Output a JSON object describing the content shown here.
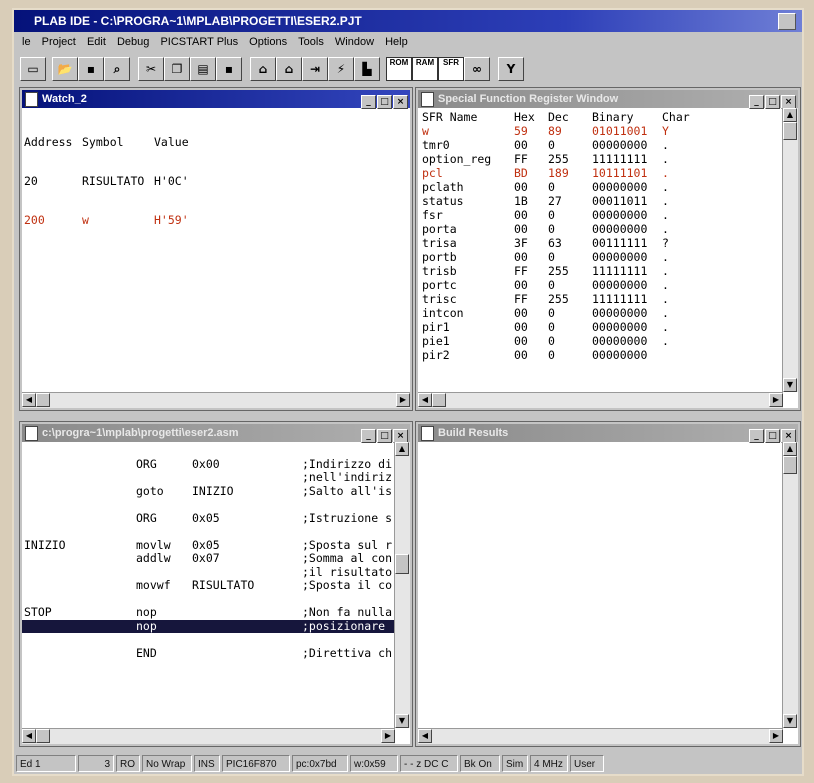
{
  "app": {
    "title": "PLAB IDE - C:\\PROGRA~1\\MPLAB\\PROGETTI\\ESER2.PJT"
  },
  "menu": [
    "le",
    "Project",
    "Edit",
    "Debug",
    "PICSTART Plus",
    "Options",
    "Tools",
    "Window",
    "Help"
  ],
  "toolbar": {
    "icons": [
      "project-icon",
      "open-icon",
      "save-icon",
      "find-icon",
      "cut-icon",
      "copy-icon",
      "paste-icon",
      "save-all-icon",
      "run-icon",
      "halt-icon",
      "step-icon",
      "animate-icon",
      "reset-icon",
      "rom-icon",
      "ram-icon",
      "sfr-icon",
      "watch-icon",
      "filter-icon"
    ],
    "rom_label": "ROM",
    "ram_label": "RAM",
    "sfr_label": "SFR"
  },
  "watch": {
    "title": "Watch_2",
    "headers": [
      "Address",
      "Symbol",
      "Value"
    ],
    "rows": [
      {
        "address": "20",
        "symbol": "RISULTATO",
        "value": "H'0C'",
        "changed": false
      },
      {
        "address": "200",
        "symbol": "w",
        "value": "H'59'",
        "changed": true
      }
    ]
  },
  "sfr": {
    "title": "Special Function Register Window",
    "headers": [
      "SFR Name",
      "Hex",
      "Dec",
      "Binary",
      "Char"
    ],
    "rows": [
      {
        "name": "w",
        "hex": "59",
        "dec": "89",
        "bin": "01011001",
        "ch": "Y",
        "changed": true
      },
      {
        "name": "tmr0",
        "hex": "00",
        "dec": "0",
        "bin": "00000000",
        "ch": ".",
        "changed": false
      },
      {
        "name": "option_reg",
        "hex": "FF",
        "dec": "255",
        "bin": "11111111",
        "ch": ".",
        "changed": false
      },
      {
        "name": "pcl",
        "hex": "BD",
        "dec": "189",
        "bin": "10111101",
        "ch": ".",
        "changed": true
      },
      {
        "name": "pclath",
        "hex": "00",
        "dec": "0",
        "bin": "00000000",
        "ch": ".",
        "changed": false
      },
      {
        "name": "status",
        "hex": "1B",
        "dec": "27",
        "bin": "00011011",
        "ch": ".",
        "changed": false
      },
      {
        "name": "fsr",
        "hex": "00",
        "dec": "0",
        "bin": "00000000",
        "ch": ".",
        "changed": false
      },
      {
        "name": "porta",
        "hex": "00",
        "dec": "0",
        "bin": "00000000",
        "ch": ".",
        "changed": false
      },
      {
        "name": "trisa",
        "hex": "3F",
        "dec": "63",
        "bin": "00111111",
        "ch": "?",
        "changed": false
      },
      {
        "name": "portb",
        "hex": "00",
        "dec": "0",
        "bin": "00000000",
        "ch": ".",
        "changed": false
      },
      {
        "name": "trisb",
        "hex": "FF",
        "dec": "255",
        "bin": "11111111",
        "ch": ".",
        "changed": false
      },
      {
        "name": "portc",
        "hex": "00",
        "dec": "0",
        "bin": "00000000",
        "ch": ".",
        "changed": false
      },
      {
        "name": "trisc",
        "hex": "FF",
        "dec": "255",
        "bin": "11111111",
        "ch": ".",
        "changed": false
      },
      {
        "name": "intcon",
        "hex": "00",
        "dec": "0",
        "bin": "00000000",
        "ch": ".",
        "changed": false
      },
      {
        "name": "pir1",
        "hex": "00",
        "dec": "0",
        "bin": "00000000",
        "ch": ".",
        "changed": false
      },
      {
        "name": "pie1",
        "hex": "00",
        "dec": "0",
        "bin": "00000000",
        "ch": ".",
        "changed": false
      },
      {
        "name": "pir2",
        "hex": "00",
        "dec": "0",
        "bin": "00000000",
        "ch": "",
        "changed": false
      }
    ]
  },
  "editor": {
    "title": "c:\\progra~1\\mplab\\progetti\\eser2.asm",
    "lines": [
      {
        "label": "",
        "op": "",
        "arg": "",
        "comment": ""
      },
      {
        "label": "",
        "op": "ORG",
        "arg": "0x00",
        "comment": ";Indirizzo di"
      },
      {
        "label": "",
        "op": "",
        "arg": "",
        "comment": ";nell'indiriz"
      },
      {
        "label": "",
        "op": "goto",
        "arg": "INIZIO",
        "comment": ";Salto all'is"
      },
      {
        "label": "",
        "op": "",
        "arg": "",
        "comment": ""
      },
      {
        "label": "",
        "op": "ORG",
        "arg": "0x05",
        "comment": ";Istruzione s"
      },
      {
        "label": "",
        "op": "",
        "arg": "",
        "comment": ""
      },
      {
        "label": "INIZIO",
        "op": "movlw",
        "arg": "0x05",
        "comment": ";Sposta sul r"
      },
      {
        "label": "",
        "op": "addlw",
        "arg": "0x07",
        "comment": ";Somma al con"
      },
      {
        "label": "",
        "op": "",
        "arg": "",
        "comment": ";il risultato"
      },
      {
        "label": "",
        "op": "movwf",
        "arg": "RISULTATO",
        "comment": ";Sposta il co"
      },
      {
        "label": "",
        "op": "",
        "arg": "",
        "comment": ""
      },
      {
        "label": "STOP",
        "op": "nop",
        "arg": "",
        "comment": ";Non fa nulla"
      },
      {
        "label": "",
        "op": "nop",
        "arg": "",
        "comment": ";posizionare",
        "selected": true
      },
      {
        "label": "",
        "op": "",
        "arg": "",
        "comment": ""
      },
      {
        "label": "",
        "op": "END",
        "arg": "",
        "comment": ";Direttiva ch"
      }
    ]
  },
  "build": {
    "title": "Build Results"
  },
  "statusbar": [
    "Ed 1",
    "3",
    "RO",
    "No Wrap",
    "INS",
    "PIC16F870",
    "pc:0x7bd",
    "w:0x59",
    "- - z DC C",
    "Bk On",
    "Sim",
    "4 MHz",
    "User"
  ],
  "colors": {
    "titlebar_active": "#05127a",
    "changed_value": "#c03010",
    "selection": "#16163c"
  }
}
